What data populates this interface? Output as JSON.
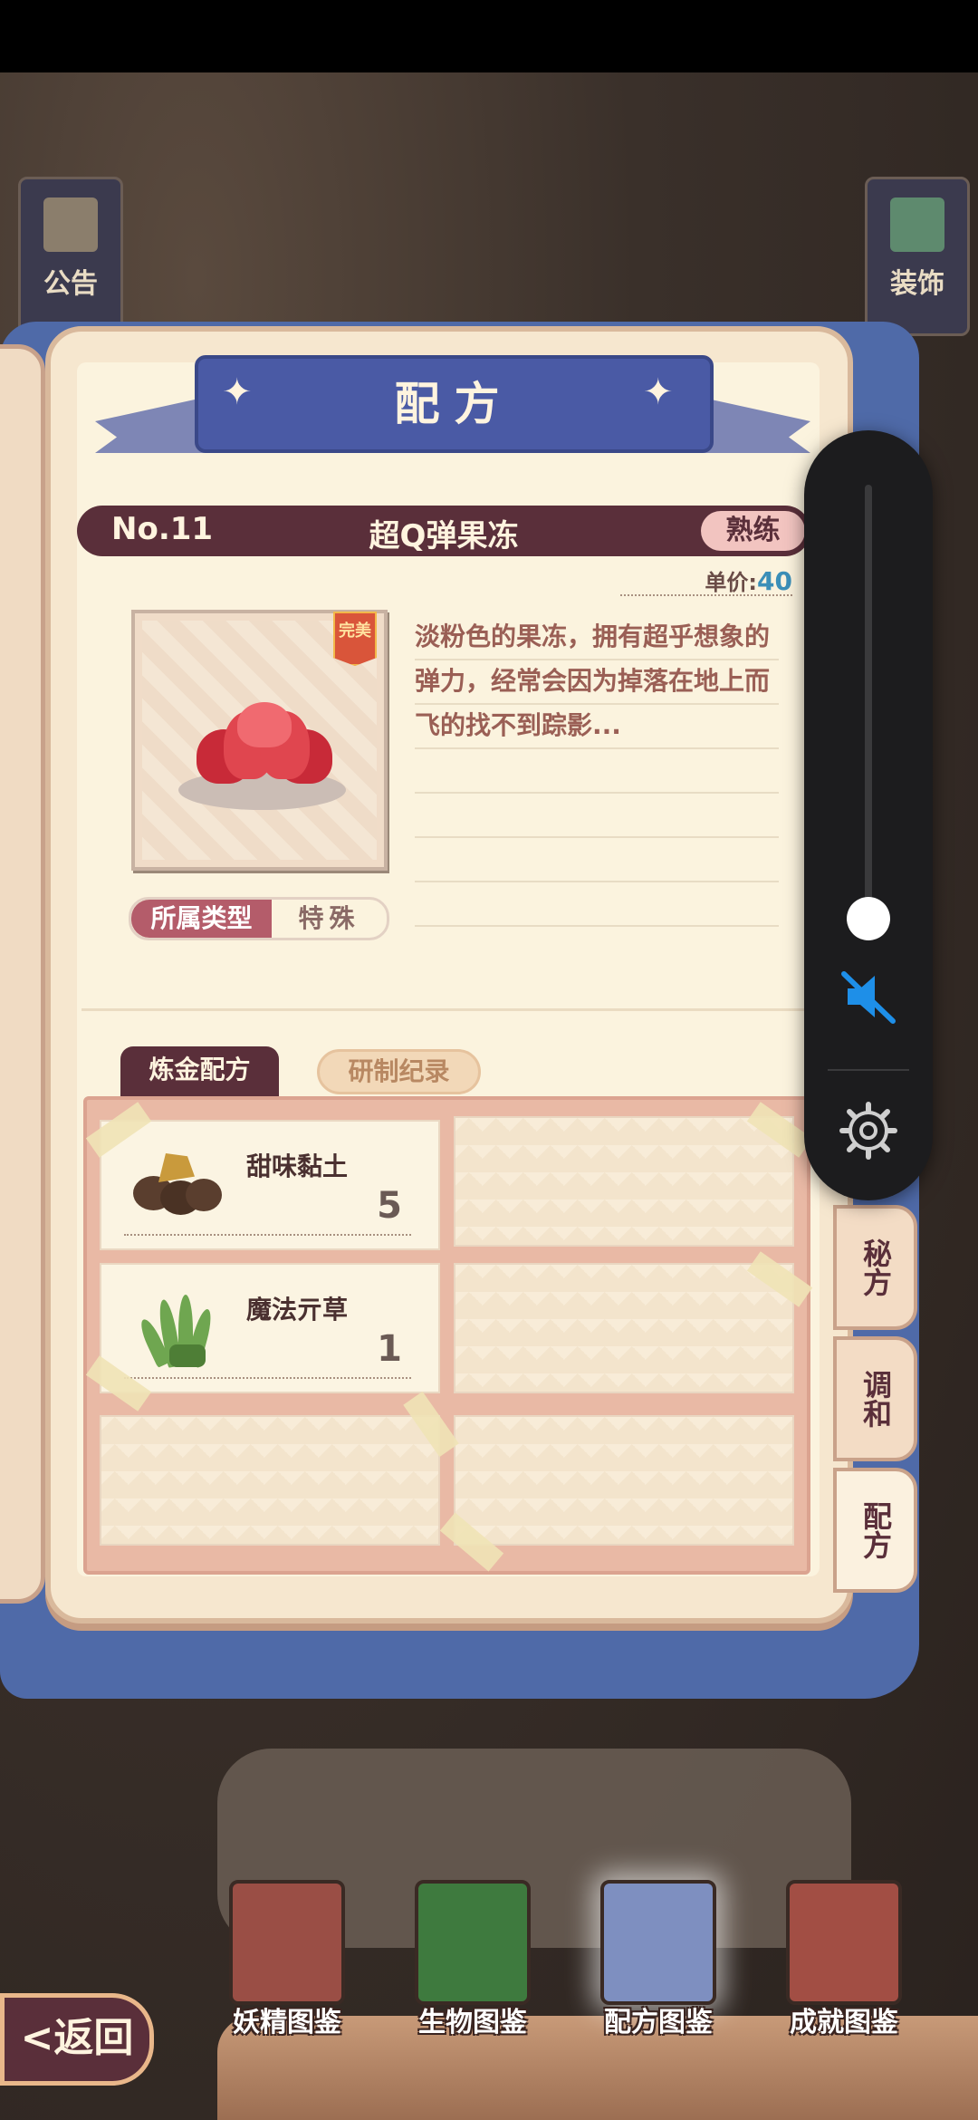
{
  "header": {
    "notice_label": "公告",
    "decor_label": "装饰"
  },
  "book": {
    "title": "配方",
    "item_no": "No.11",
    "item_name": "超Q弹果冻",
    "rank": "熟练",
    "price_label": "单价:",
    "price_value": "40",
    "quality_badge": "完美",
    "description": "淡粉色的果冻，拥有超乎想象的弹力，经常会因为掉落在地上而飞的找不到踪影...",
    "type_label": "所属类型",
    "type_value": "特殊",
    "tabs": [
      {
        "label": "炼金配方",
        "active": true
      },
      {
        "label": "研制纪录",
        "active": false
      }
    ],
    "ingredients": [
      {
        "name": "甜味黏土",
        "count": "5",
        "icon": "clay-icon"
      },
      {
        "name": "魔法亓草",
        "count": "1",
        "icon": "herb-icon"
      }
    ],
    "side_tabs": [
      {
        "label": "秘方",
        "active": false
      },
      {
        "label": "调和",
        "active": false
      },
      {
        "label": "配方",
        "active": true
      }
    ]
  },
  "volume": {
    "level": 0.08,
    "muted": true
  },
  "bottom_nav": [
    {
      "label": "妖精图鉴",
      "color": "#9a4e45",
      "active": false
    },
    {
      "label": "生物图鉴",
      "color": "#3e7a3e",
      "active": false
    },
    {
      "label": "配方图鉴",
      "color": "#7e8fc0",
      "active": true
    },
    {
      "label": "成就图鉴",
      "color": "#a24e44",
      "active": false
    }
  ],
  "back_label": "<返回"
}
